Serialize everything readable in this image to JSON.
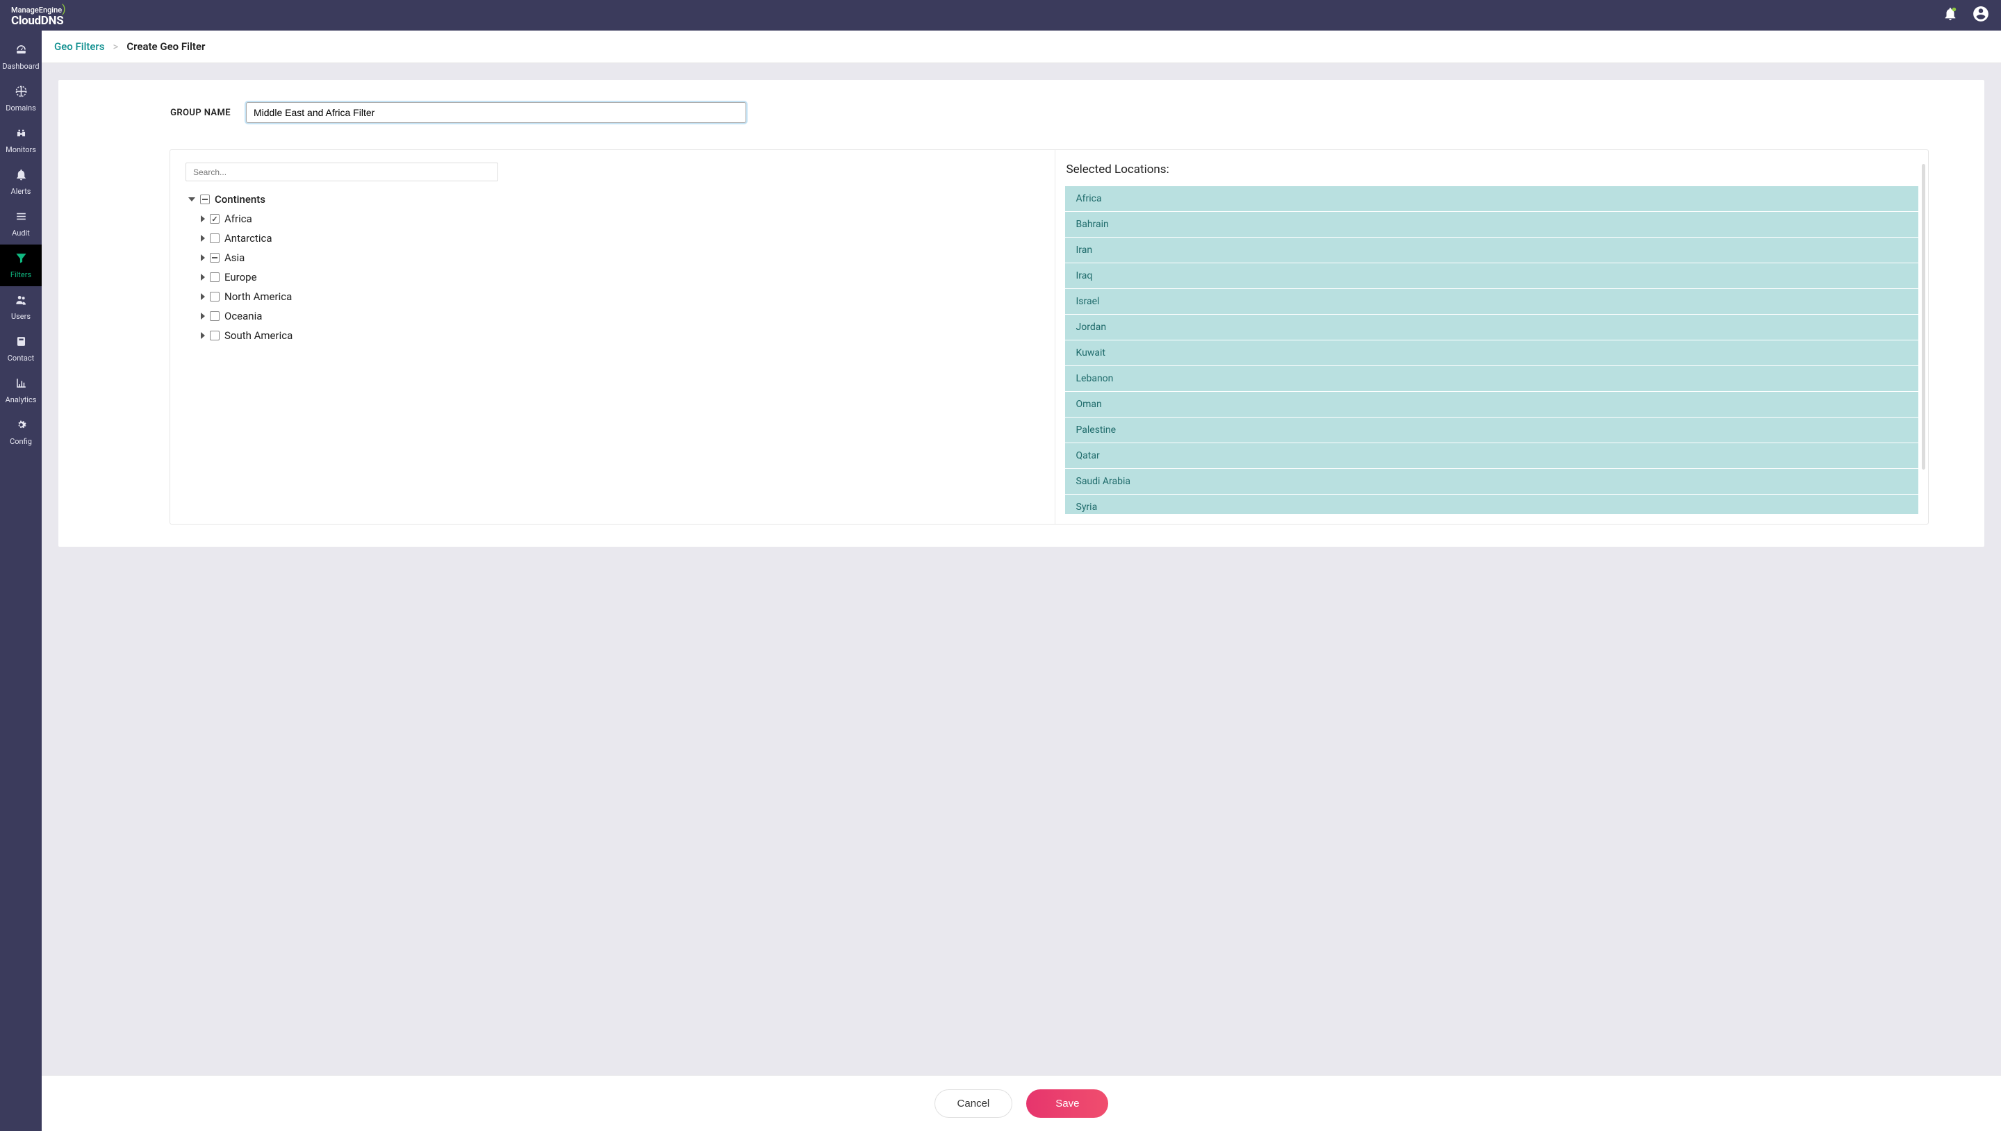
{
  "topbar": {
    "logo_top": "ManageEngine",
    "logo_bottom": "CloudDNS"
  },
  "sidebar": {
    "items": [
      {
        "id": "dashboard",
        "label": "Dashboard",
        "icon": "gauge"
      },
      {
        "id": "domains",
        "label": "Domains",
        "icon": "globe"
      },
      {
        "id": "monitors",
        "label": "Monitors",
        "icon": "binoculars"
      },
      {
        "id": "alerts",
        "label": "Alerts",
        "icon": "bell"
      },
      {
        "id": "audit",
        "label": "Audit",
        "icon": "list"
      },
      {
        "id": "filters",
        "label": "Filters",
        "icon": "funnel",
        "active": true
      },
      {
        "id": "users",
        "label": "Users",
        "icon": "users"
      },
      {
        "id": "contact",
        "label": "Contact",
        "icon": "card"
      },
      {
        "id": "analytics",
        "label": "Analytics",
        "icon": "chart"
      },
      {
        "id": "config",
        "label": "Config",
        "icon": "gears"
      }
    ]
  },
  "breadcrumb": {
    "parent": "Geo Filters",
    "separator": ">",
    "current": "Create Geo Filter"
  },
  "form": {
    "group_name_label": "GROUP NAME",
    "group_name_value": "Middle East and Africa Filter"
  },
  "picker": {
    "search_placeholder": "Search...",
    "root_label": "Continents",
    "continents": [
      {
        "label": "Africa",
        "state": "checked"
      },
      {
        "label": "Antarctica",
        "state": "unchecked"
      },
      {
        "label": "Asia",
        "state": "indeterminate"
      },
      {
        "label": "Europe",
        "state": "unchecked"
      },
      {
        "label": "North America",
        "state": "unchecked"
      },
      {
        "label": "Oceania",
        "state": "unchecked"
      },
      {
        "label": "South America",
        "state": "unchecked"
      }
    ],
    "selected_title": "Selected Locations:",
    "selected": [
      "Africa",
      "Bahrain",
      "Iran",
      "Iraq",
      "Israel",
      "Jordan",
      "Kuwait",
      "Lebanon",
      "Oman",
      "Palestine",
      "Qatar",
      "Saudi Arabia",
      "Syria"
    ]
  },
  "footer": {
    "cancel_label": "Cancel",
    "save_label": "Save"
  }
}
